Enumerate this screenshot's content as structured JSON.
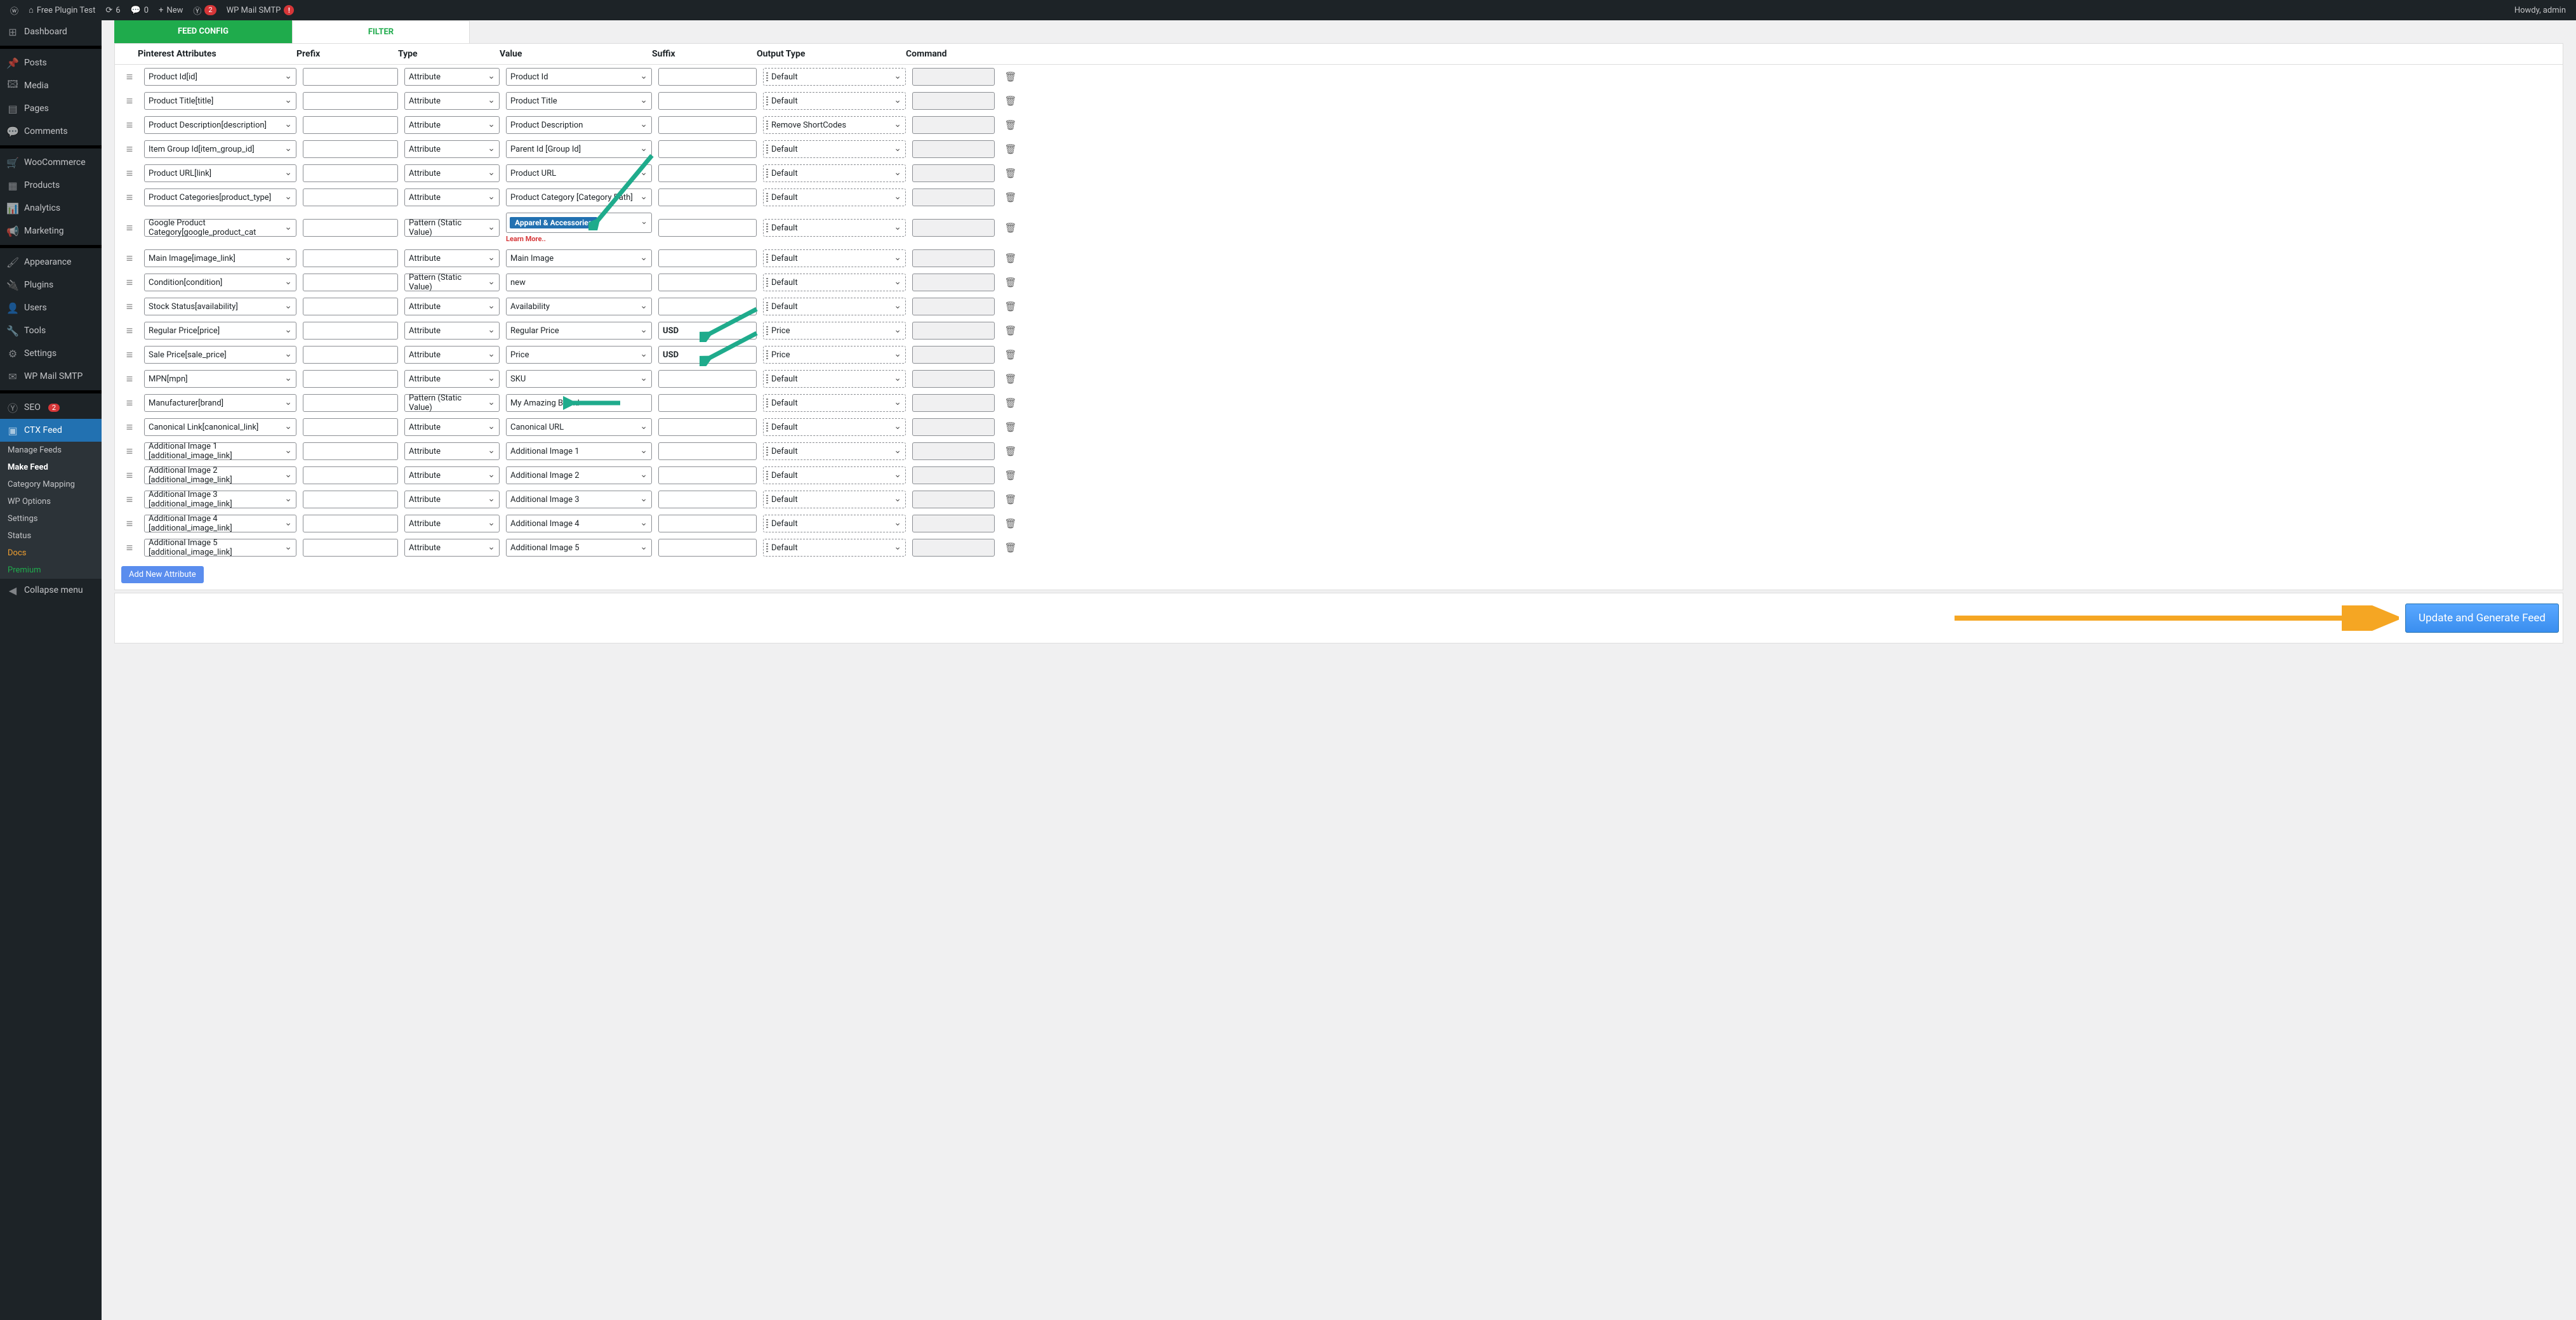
{
  "adminbar": {
    "site_name": "Free Plugin Test",
    "updates": "6",
    "comments": "0",
    "new": "New",
    "yoast_count": "2",
    "wp_mail": "WP Mail SMTP",
    "howdy": "Howdy, admin"
  },
  "sidebar": {
    "items": [
      {
        "icon": "⊞",
        "label": "Dashboard"
      },
      {
        "icon": "📌",
        "label": "Posts"
      },
      {
        "icon": "🖾",
        "label": "Media"
      },
      {
        "icon": "▤",
        "label": "Pages"
      },
      {
        "icon": "💬",
        "label": "Comments"
      },
      {
        "icon": "🛒",
        "label": "WooCommerce"
      },
      {
        "icon": "▦",
        "label": "Products"
      },
      {
        "icon": "📊",
        "label": "Analytics"
      },
      {
        "icon": "📢",
        "label": "Marketing"
      },
      {
        "icon": "🖌",
        "label": "Appearance"
      },
      {
        "icon": "🔌",
        "label": "Plugins"
      },
      {
        "icon": "👤",
        "label": "Users"
      },
      {
        "icon": "🔧",
        "label": "Tools"
      },
      {
        "icon": "⚙",
        "label": "Settings"
      },
      {
        "icon": "✉",
        "label": "WP Mail SMTP"
      },
      {
        "icon": "Ⓨ",
        "label": "SEO",
        "badge": "2"
      },
      {
        "icon": "▣",
        "label": "CTX Feed",
        "active": true
      }
    ],
    "sub": [
      {
        "label": "Manage Feeds"
      },
      {
        "label": "Make Feed",
        "bold": true
      },
      {
        "label": "Category Mapping"
      },
      {
        "label": "WP Options"
      },
      {
        "label": "Settings"
      },
      {
        "label": "Status"
      },
      {
        "label": "Docs",
        "cls": "orange"
      },
      {
        "label": "Premium",
        "cls": "green"
      }
    ],
    "collapse": "Collapse menu"
  },
  "tabs": {
    "config": "FEED CONFIG",
    "filter": "FILTER"
  },
  "headers": {
    "attr": "Pinterest Attributes",
    "prefix": "Prefix",
    "type": "Type",
    "value": "Value",
    "suffix": "Suffix",
    "output": "Output Type",
    "command": "Command"
  },
  "rows": [
    {
      "attr": "Product Id[id]",
      "type": "Attribute",
      "value": "Product Id",
      "vtype": "select",
      "output": "Default"
    },
    {
      "attr": "Product Title[title]",
      "type": "Attribute",
      "value": "Product Title",
      "vtype": "select",
      "output": "Default"
    },
    {
      "attr": "Product Description[description]",
      "type": "Attribute",
      "value": "Product Description",
      "vtype": "select",
      "output": "Remove ShortCodes"
    },
    {
      "attr": "Item Group Id[item_group_id]",
      "type": "Attribute",
      "value": "Parent Id [Group Id]",
      "vtype": "select",
      "output": "Default"
    },
    {
      "attr": "Product URL[link]",
      "type": "Attribute",
      "value": "Product URL",
      "vtype": "select",
      "output": "Default"
    },
    {
      "attr": "Product Categories[product_type]",
      "type": "Attribute",
      "value": "Product Category [Category Path]",
      "vtype": "select",
      "output": "Default"
    },
    {
      "attr": "Google Product Category[google_product_cat",
      "type": "Pattern (Static Value)",
      "value": "Apparel & Accessories",
      "vtype": "pill",
      "learn": "Learn More..",
      "output": "Default"
    },
    {
      "attr": "Main Image[image_link]",
      "type": "Attribute",
      "value": "Main Image",
      "vtype": "select",
      "output": "Default"
    },
    {
      "attr": "Condition[condition]",
      "type": "Pattern (Static Value)",
      "value": "new",
      "vtype": "input",
      "output": "Default"
    },
    {
      "attr": "Stock Status[availability]",
      "type": "Attribute",
      "value": "Availability",
      "vtype": "select",
      "output": "Default"
    },
    {
      "attr": "Regular Price[price]",
      "type": "Attribute",
      "value": "Regular Price",
      "vtype": "select",
      "suffix": "USD",
      "output": "Price"
    },
    {
      "attr": "Sale Price[sale_price]",
      "type": "Attribute",
      "value": "Price",
      "vtype": "select",
      "suffix": "USD",
      "output": "Price"
    },
    {
      "attr": "MPN[mpn]",
      "type": "Attribute",
      "value": "SKU",
      "vtype": "select",
      "output": "Default"
    },
    {
      "attr": "Manufacturer[brand]",
      "type": "Pattern (Static Value)",
      "value": "My Amazing Brand",
      "vtype": "input",
      "output": "Default"
    },
    {
      "attr": "Canonical Link[canonical_link]",
      "type": "Attribute",
      "value": "Canonical URL",
      "vtype": "select",
      "output": "Default"
    },
    {
      "attr": "Additional Image 1 [additional_image_link]",
      "type": "Attribute",
      "value": "Additional Image 1",
      "vtype": "select",
      "output": "Default"
    },
    {
      "attr": "Additional Image 2 [additional_image_link]",
      "type": "Attribute",
      "value": "Additional Image 2",
      "vtype": "select",
      "output": "Default"
    },
    {
      "attr": "Additional Image 3 [additional_image_link]",
      "type": "Attribute",
      "value": "Additional Image 3",
      "vtype": "select",
      "output": "Default"
    },
    {
      "attr": "Additional Image 4 [additional_image_link]",
      "type": "Attribute",
      "value": "Additional Image 4",
      "vtype": "select",
      "output": "Default"
    },
    {
      "attr": "Additional Image 5 [additional_image_link]",
      "type": "Attribute",
      "value": "Additional Image 5",
      "vtype": "select",
      "output": "Default"
    }
  ],
  "buttons": {
    "add": "Add New Attribute",
    "generate": "Update and Generate Feed"
  }
}
